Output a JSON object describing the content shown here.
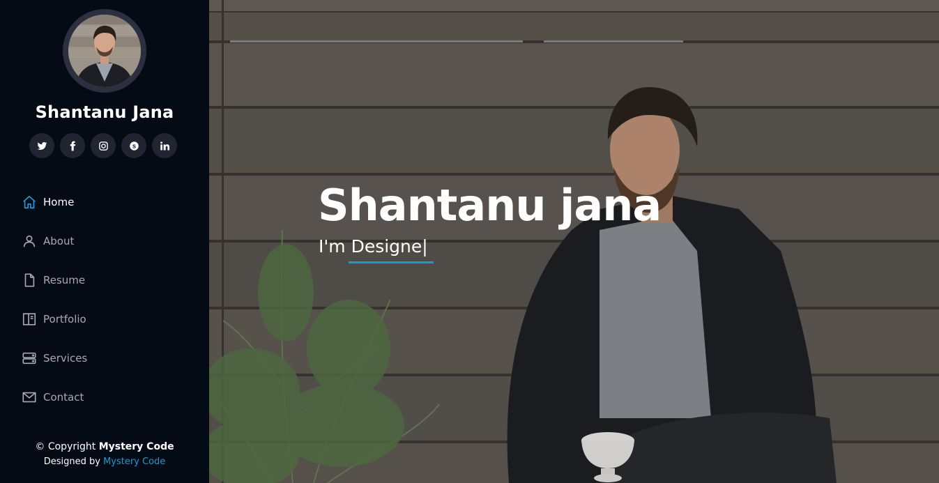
{
  "profile": {
    "name": "Shantanu Jana",
    "avatar_icon": "profile-photo"
  },
  "social": [
    {
      "name": "twitter-icon",
      "label": "Twitter"
    },
    {
      "name": "facebook-icon",
      "label": "Facebook"
    },
    {
      "name": "instagram-icon",
      "label": "Instagram"
    },
    {
      "name": "skype-icon",
      "label": "Skype"
    },
    {
      "name": "linkedin-icon",
      "label": "LinkedIn"
    }
  ],
  "nav": {
    "items": [
      {
        "label": "Home",
        "icon": "home-icon",
        "active": true
      },
      {
        "label": "About",
        "icon": "user-icon",
        "active": false
      },
      {
        "label": "Resume",
        "icon": "file-icon",
        "active": false
      },
      {
        "label": "Portfolio",
        "icon": "book-icon",
        "active": false
      },
      {
        "label": "Services",
        "icon": "server-icon",
        "active": false
      },
      {
        "label": "Contact",
        "icon": "envelope-icon",
        "active": false
      }
    ]
  },
  "footer": {
    "copyright_prefix": "© Copyright",
    "copyright_brand": "Mystery Code",
    "credits_prefix": "Designed by",
    "credits_link": "Mystery Code"
  },
  "hero": {
    "title": "Shantanu jana",
    "subtitle_prefix": "I'm",
    "subtitle_typed": "Designe",
    "cursor": "|"
  },
  "colors": {
    "accent": "#149ddd",
    "sidebar_bg": "#040b14",
    "social_bg": "#212431",
    "nav_text": "#a8a9b4"
  }
}
